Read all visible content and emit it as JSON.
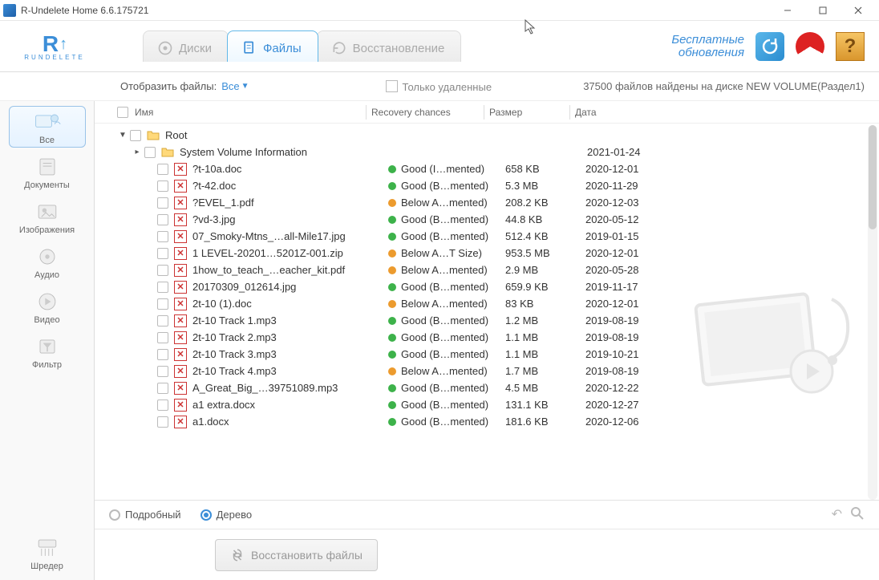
{
  "window": {
    "title": "R-Undelete Home 6.6.175721"
  },
  "logo": {
    "big": "R",
    "suffix": "↑",
    "small": "RUNDELETE"
  },
  "tabs": [
    {
      "id": "disks",
      "label": "Диски"
    },
    {
      "id": "files",
      "label": "Файлы"
    },
    {
      "id": "restore",
      "label": "Восстановление"
    }
  ],
  "header": {
    "free_updates_l1": "Бесплатные",
    "free_updates_l2": "обновления",
    "help": "?"
  },
  "filter": {
    "show_label": "Отобразить файлы:",
    "all": "Все",
    "only_deleted": "Только удаленные",
    "count_text": "37500 файлов найдены на диске NEW VOLUME(Раздел1)"
  },
  "sidebar": [
    {
      "id": "all",
      "label": "Все"
    },
    {
      "id": "docs",
      "label": "Документы"
    },
    {
      "id": "images",
      "label": "Изображения"
    },
    {
      "id": "audio",
      "label": "Аудио"
    },
    {
      "id": "video",
      "label": "Видео"
    },
    {
      "id": "filter",
      "label": "Фильтр"
    }
  ],
  "shredder_label": "Шредер",
  "columns": {
    "name": "Имя",
    "recovery": "Recovery chances",
    "size": "Размер",
    "date": "Дата"
  },
  "root_label": "Root",
  "svi_label": "System Volume Information",
  "svi_date": "2021-01-24",
  "files": [
    {
      "name": "?t-10a.doc",
      "rec": "Good (I…mented)",
      "dot": "green",
      "size": "658 KB",
      "date": "2020-12-01"
    },
    {
      "name": "?t-42.doc",
      "rec": "Good (B…mented)",
      "dot": "green",
      "size": "5.3 MB",
      "date": "2020-11-29"
    },
    {
      "name": "?EVEL_1.pdf",
      "rec": "Below A…mented)",
      "dot": "orange",
      "size": "208.2 KB",
      "date": "2020-12-03"
    },
    {
      "name": "?vd-3.jpg",
      "rec": "Good (B…mented)",
      "dot": "green",
      "size": "44.8 KB",
      "date": "2020-05-12"
    },
    {
      "name": "07_Smoky-Mtns_…all-Mile17.jpg",
      "rec": "Good (B…mented)",
      "dot": "green",
      "size": "512.4 KB",
      "date": "2019-01-15"
    },
    {
      "name": "1 LEVEL-20201…5201Z-001.zip",
      "rec": "Below A…T Size)",
      "dot": "orange",
      "size": "953.5 MB",
      "date": "2020-12-01"
    },
    {
      "name": "1how_to_teach_…eacher_kit.pdf",
      "rec": "Below A…mented)",
      "dot": "orange",
      "size": "2.9 MB",
      "date": "2020-05-28"
    },
    {
      "name": "20170309_012614.jpg",
      "rec": "Good (B…mented)",
      "dot": "green",
      "size": "659.9 KB",
      "date": "2019-11-17"
    },
    {
      "name": "2t-10 (1).doc",
      "rec": "Below A…mented)",
      "dot": "orange",
      "size": "83 KB",
      "date": "2020-12-01"
    },
    {
      "name": "2t-10 Track 1.mp3",
      "rec": "Good (B…mented)",
      "dot": "green",
      "size": "1.2 MB",
      "date": "2019-08-19"
    },
    {
      "name": "2t-10 Track 2.mp3",
      "rec": "Good (B…mented)",
      "dot": "green",
      "size": "1.1 MB",
      "date": "2019-08-19"
    },
    {
      "name": "2t-10 Track 3.mp3",
      "rec": "Good (B…mented)",
      "dot": "green",
      "size": "1.1 MB",
      "date": "2019-10-21"
    },
    {
      "name": "2t-10 Track 4.mp3",
      "rec": "Below A…mented)",
      "dot": "orange",
      "size": "1.7 MB",
      "date": "2019-08-19"
    },
    {
      "name": "A_Great_Big_…39751089.mp3",
      "rec": "Good (B…mented)",
      "dot": "green",
      "size": "4.5 MB",
      "date": "2020-12-22"
    },
    {
      "name": "a1 extra.docx",
      "rec": "Good (B…mented)",
      "dot": "green",
      "size": "131.1 KB",
      "date": "2020-12-27"
    },
    {
      "name": "a1.docx",
      "rec": "Good (B…mented)",
      "dot": "green",
      "size": "181.6 KB",
      "date": "2020-12-06"
    }
  ],
  "view": {
    "detailed": "Подробный",
    "tree": "Дерево"
  },
  "restore_btn": "Восстановить файлы"
}
